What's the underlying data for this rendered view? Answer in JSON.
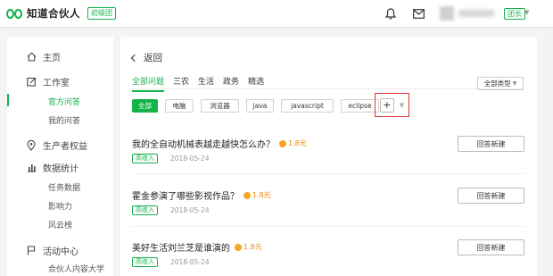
{
  "header": {
    "brand": "知道合伙人",
    "level_badge": "初级团",
    "user_level": "团长"
  },
  "sidebar": {
    "items": [
      {
        "label": "主页",
        "icon": "home-icon"
      },
      {
        "label": "工作室",
        "icon": "edit-icon",
        "children": [
          {
            "label": "官方问答",
            "active": true
          },
          {
            "label": "我的问答"
          }
        ]
      },
      {
        "label": "生产者权益",
        "icon": "location-icon"
      },
      {
        "label": "数据统计",
        "icon": "bar-chart-icon",
        "children": [
          {
            "label": "任务数据"
          },
          {
            "label": "影响力"
          },
          {
            "label": "风云榜"
          }
        ]
      },
      {
        "label": "活动中心",
        "icon": "flag-icon",
        "children": [
          {
            "label": "合伙人内容大学"
          }
        ]
      }
    ]
  },
  "main": {
    "back_label": "返回",
    "tabs": [
      "全部问题",
      "三农",
      "生活",
      "政务",
      "精选"
    ],
    "type_select": "全部类型",
    "chips": [
      "全部",
      "电脑",
      "浏览器",
      "java",
      "javascript",
      "eclipse"
    ],
    "add_symbol": "+",
    "questions": [
      {
        "title": "我的全自动机械表越走越快怎么办？",
        "reward": "1.8元",
        "tag": "高收入",
        "date": "2018-05-24",
        "action": "回答新建"
      },
      {
        "title": "霍金参演了哪些影视作品？",
        "reward": "1.8元",
        "tag": "高收入",
        "date": "2018-05-24",
        "action": "回答新建"
      },
      {
        "title": "美好生活刘兰芝是谁演的",
        "reward": "1.8元",
        "tag": "高收入",
        "date": "2018-05-24",
        "action": "回答新建"
      }
    ]
  },
  "colors": {
    "accent": "#14b24a",
    "reward": "#f08a00",
    "highlight": "#e23636"
  }
}
